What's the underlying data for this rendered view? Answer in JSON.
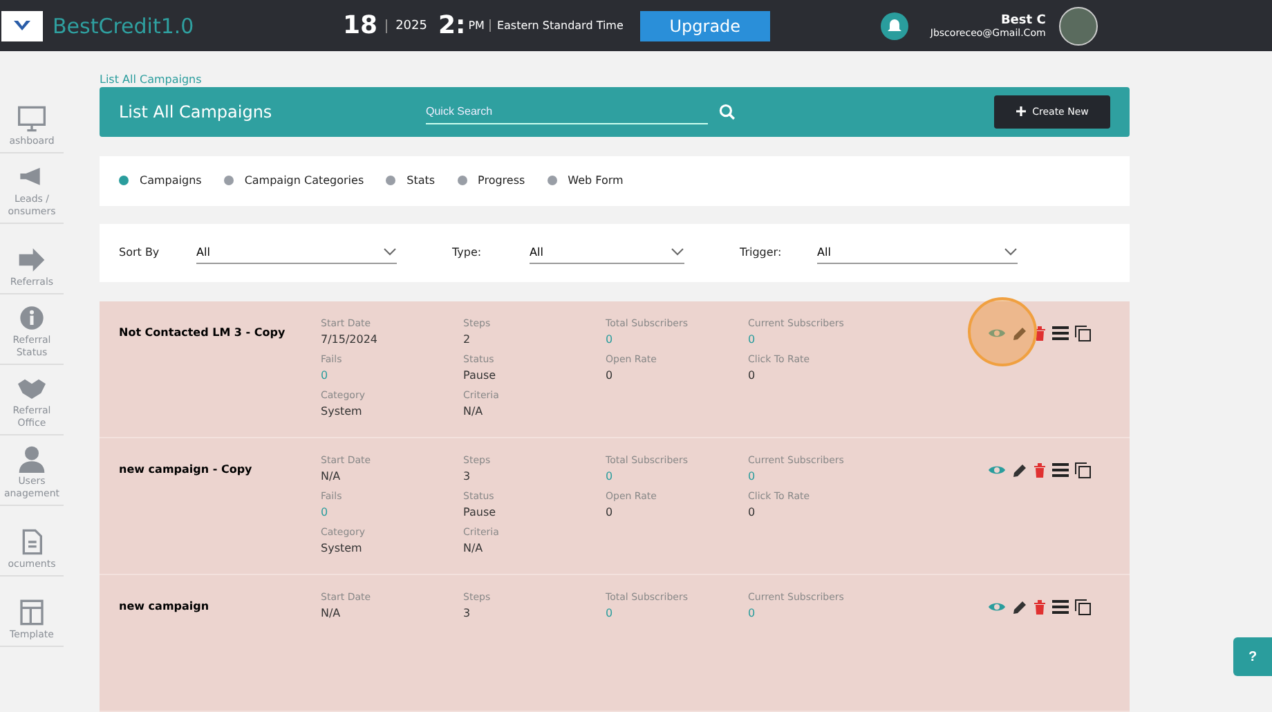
{
  "header": {
    "brand": "BestCredit1.0",
    "day": "18",
    "year": "2025",
    "time": "2:",
    "meridiem": "PM",
    "timezone": "Eastern Standard Time",
    "upgrade": "Upgrade",
    "user_name": "Best C",
    "user_email": "Jbscoreceo@Gmail.Com"
  },
  "sidebar": {
    "items": [
      {
        "label": "ashboard"
      },
      {
        "label": "Leads / onsumers"
      },
      {
        "label": "Referrals"
      },
      {
        "label": "Referral Status"
      },
      {
        "label": "Referral Office"
      },
      {
        "label": "Users anagement"
      },
      {
        "label": "ocuments"
      },
      {
        "label": "Template"
      }
    ]
  },
  "breadcrumb": "List All Campaigns",
  "title_bar": {
    "title": "List All Campaigns",
    "search": {
      "placeholder": "Quick Search"
    },
    "create_button": "Create New"
  },
  "tabs": [
    {
      "label": "Campaigns",
      "selected": true
    },
    {
      "label": "Campaign Categories",
      "selected": false
    },
    {
      "label": "Stats",
      "selected": false
    },
    {
      "label": "Progress",
      "selected": false
    },
    {
      "label": "Web Form",
      "selected": false
    }
  ],
  "filters": [
    {
      "label": "Sort By",
      "value": "All"
    },
    {
      "label": "Type:",
      "value": "All"
    },
    {
      "label": "Trigger:",
      "value": "All"
    }
  ],
  "campaigns": [
    {
      "name": "Not Contacted LM 3 - Copy",
      "highlighted": true,
      "fields": [
        {
          "label": "Start Date",
          "value": "7/15/2024",
          "kind": "plain"
        },
        {
          "label": "Steps",
          "value": "2",
          "kind": "plain"
        },
        {
          "label": "Total Subscribers",
          "value": "0",
          "kind": "link"
        },
        {
          "label": "Current Subscribers",
          "value": "0",
          "kind": "link"
        },
        {
          "label": "Fails",
          "value": "0",
          "kind": "link"
        },
        {
          "label": "Status",
          "value": "Pause",
          "kind": "plain"
        },
        {
          "label": "Open Rate",
          "value": "0",
          "kind": "plain"
        },
        {
          "label": "Click To Rate",
          "value": "0",
          "kind": "plain"
        },
        {
          "label": "Category",
          "value": "System",
          "kind": "plain"
        },
        {
          "label": "Criteria",
          "value": "N/A",
          "kind": "plain"
        }
      ]
    },
    {
      "name": "new campaign - Copy",
      "highlighted": false,
      "fields": [
        {
          "label": "Start Date",
          "value": "N/A",
          "kind": "plain"
        },
        {
          "label": "Steps",
          "value": "3",
          "kind": "plain"
        },
        {
          "label": "Total Subscribers",
          "value": "0",
          "kind": "link"
        },
        {
          "label": "Current Subscribers",
          "value": "0",
          "kind": "link"
        },
        {
          "label": "Fails",
          "value": "0",
          "kind": "link"
        },
        {
          "label": "Status",
          "value": "Pause",
          "kind": "plain"
        },
        {
          "label": "Open Rate",
          "value": "0",
          "kind": "plain"
        },
        {
          "label": "Click To Rate",
          "value": "0",
          "kind": "plain"
        },
        {
          "label": "Category",
          "value": "System",
          "kind": "plain"
        },
        {
          "label": "Criteria",
          "value": "N/A",
          "kind": "plain"
        }
      ]
    },
    {
      "name": "new campaign",
      "highlighted": false,
      "fields": [
        {
          "label": "Start Date",
          "value": "N/A",
          "kind": "plain"
        },
        {
          "label": "Steps",
          "value": "3",
          "kind": "plain"
        },
        {
          "label": "Total Subscribers",
          "value": "0",
          "kind": "link"
        },
        {
          "label": "Current Subscribers",
          "value": "0",
          "kind": "link"
        }
      ]
    }
  ],
  "help_button": "?"
}
